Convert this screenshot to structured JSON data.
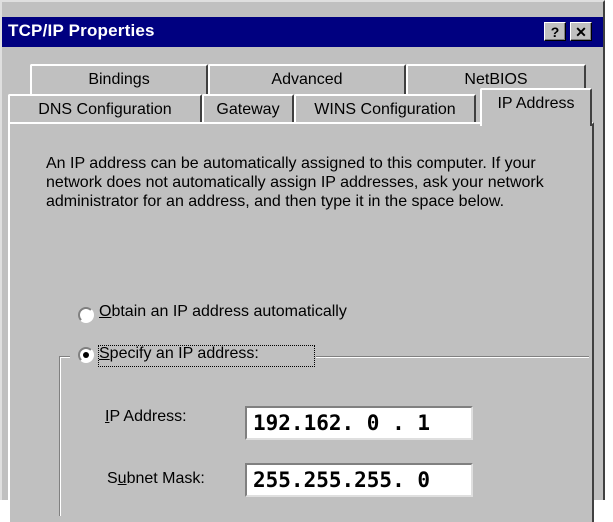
{
  "window": {
    "title": "TCP/IP Properties",
    "help_label": "?",
    "close_label": "✕"
  },
  "tabs": {
    "row1": [
      "Bindings",
      "Advanced",
      "NetBIOS"
    ],
    "row2": [
      "DNS Configuration",
      "Gateway",
      "WINS Configuration",
      "IP Address"
    ],
    "active": "IP Address"
  },
  "description": "An IP address can be automatically assigned to this computer. If your network does not automatically assign IP addresses, ask your network administrator for an address, and then type it in the space below.",
  "options": {
    "obtain": {
      "mnemonic": "O",
      "rest": "btain an IP address automatically",
      "selected": false
    },
    "specify": {
      "mnemonic": "S",
      "rest": "pecify an IP address:",
      "selected": true
    }
  },
  "fields": {
    "ip_address": {
      "label_pre": "",
      "mnemonic": "I",
      "label_post": "P Address:",
      "value": "192.162. 0 . 1"
    },
    "subnet_mask": {
      "label_pre": "S",
      "mnemonic": "u",
      "label_post": "bnet Mask:",
      "value": "255.255.255. 0"
    }
  }
}
